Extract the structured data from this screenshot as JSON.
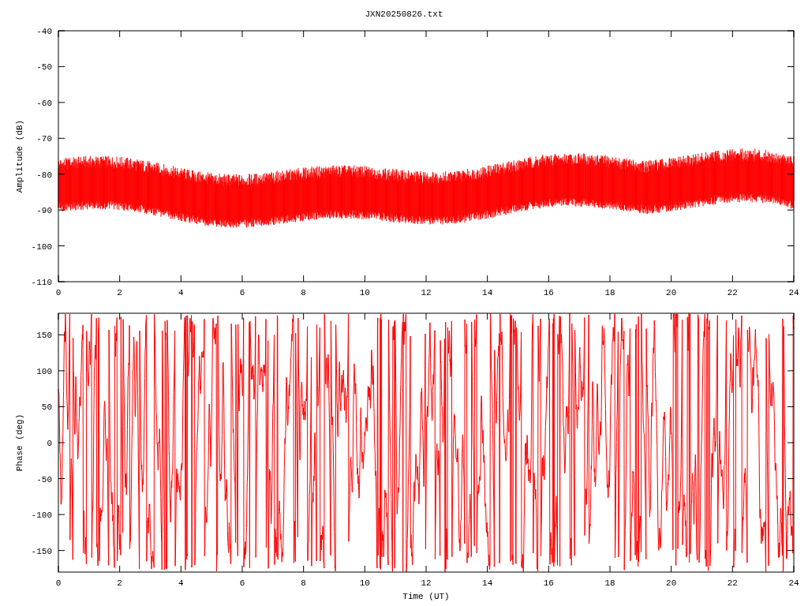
{
  "title": "JXN20250826.txt",
  "plots": [
    {
      "kind": "amplitude",
      "ylabel": "Amplitude (dB)",
      "yticks": [
        "-40",
        "-50",
        "-60",
        "-70",
        "-80",
        "-90",
        "-100",
        "-110"
      ],
      "xticks": [
        "0",
        "2",
        "4",
        "6",
        "8",
        "10",
        "12",
        "14",
        "16",
        "18",
        "20",
        "22",
        "24"
      ]
    },
    {
      "kind": "phase",
      "ylabel": "Phase (deg)",
      "yticks": [
        "150",
        "100",
        "50",
        "0",
        "-50",
        "-100",
        "-150"
      ],
      "xticks": [
        "0",
        "2",
        "4",
        "6",
        "8",
        "10",
        "12",
        "14",
        "16",
        "18",
        "20",
        "22",
        "24"
      ],
      "xlabel": "Time (UT)"
    }
  ]
}
